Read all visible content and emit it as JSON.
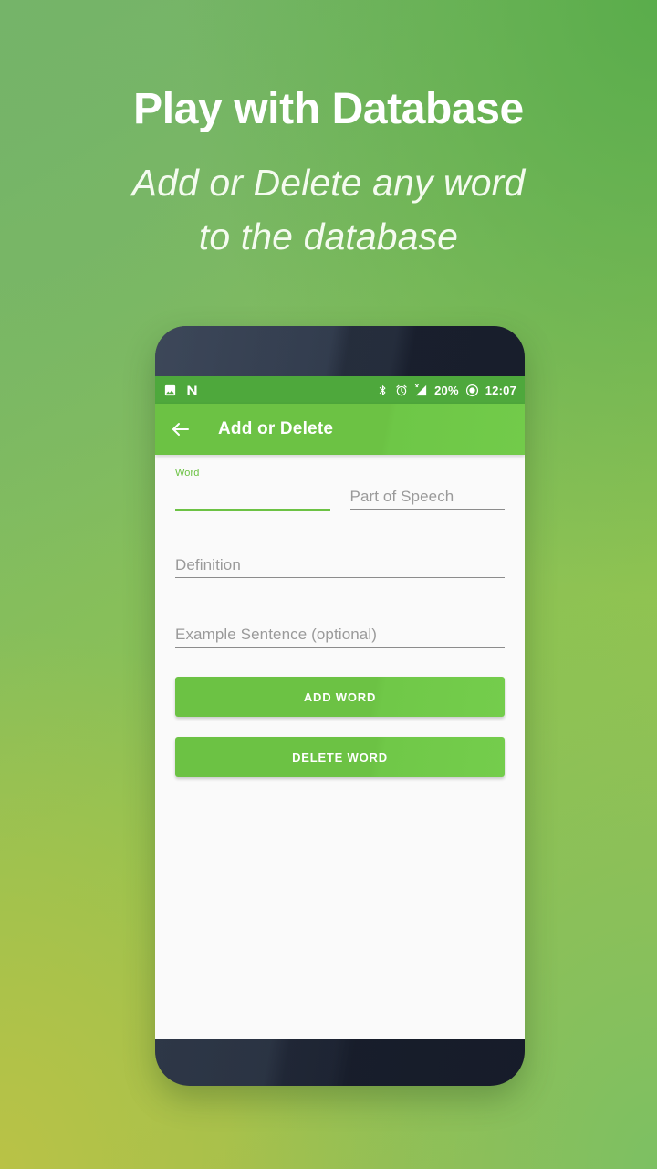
{
  "promo": {
    "title": "Play with Database",
    "subtitle": "Add or Delete any word\nto the database",
    "background_colors": {
      "top_left": "#75b469",
      "top_right": "#58ac4a",
      "bottom_left": "#bac246",
      "bottom_right": "#7ac064"
    }
  },
  "device": {
    "bezel_color": "#1b2130",
    "screen_background": "#fafafa"
  },
  "app": {
    "statusbar": {
      "background": "#4ea83c",
      "left_icons": [
        "image-icon",
        "nova-n-icon"
      ],
      "right_icons": [
        "bluetooth-icon",
        "alarm-icon",
        "signal-no-service-icon",
        "battery-icon"
      ],
      "battery_percent": "20%",
      "time": "12:07"
    },
    "toolbar": {
      "background": "#6cc244",
      "back_icon": "back-arrow-icon",
      "title": "Add or Delete"
    },
    "form": {
      "fields": [
        {
          "name": "word",
          "label": "Word",
          "value": "",
          "placeholder": "Word",
          "focused": true,
          "accent": "#6cc244"
        },
        {
          "name": "part-of-speech",
          "label": "",
          "value": "",
          "placeholder": "Part of Speech",
          "focused": false,
          "accent": "#8c8c8c"
        },
        {
          "name": "definition",
          "label": "",
          "value": "",
          "placeholder": "Definition",
          "focused": false,
          "accent": "#8c8c8c"
        },
        {
          "name": "example-sentence",
          "label": "",
          "value": "",
          "placeholder": "Example Sentence (optional)",
          "focused": false,
          "accent": "#8c8c8c"
        }
      ],
      "buttons": [
        {
          "name": "add-word",
          "label": "ADD WORD",
          "color": "#6cc244"
        },
        {
          "name": "delete-word",
          "label": "DELETE WORD",
          "color": "#6cc244"
        }
      ]
    }
  }
}
